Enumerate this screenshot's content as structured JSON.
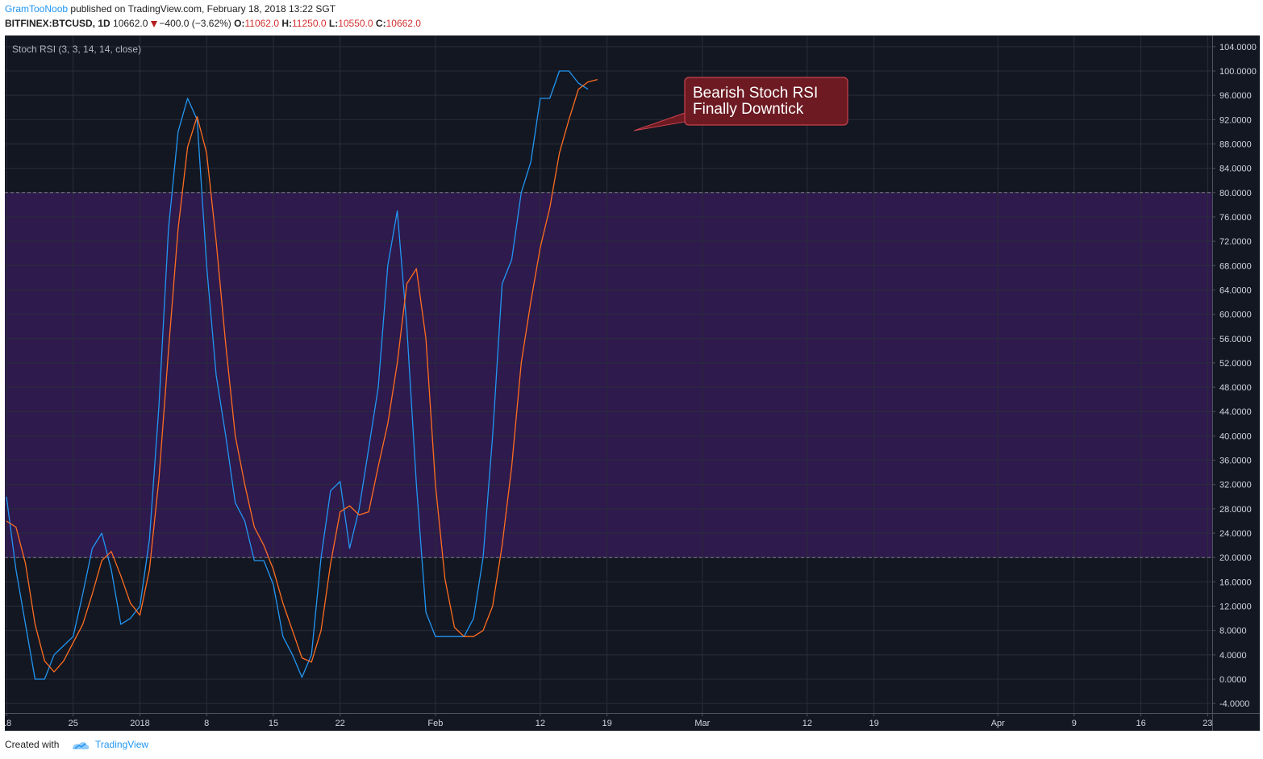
{
  "header": {
    "author": "GramTooNoob",
    "published_text": "published on TradingView.com, February 18, 2018 13:22 SGT",
    "symbol": "BITFINEX:BTCUSD, 1D",
    "price": "10662.0",
    "change": "−400.0 (−3.62%)",
    "o_label": "O:",
    "o_value": "11062.0",
    "h_label": "H:",
    "h_value": "11250.0",
    "l_label": "L:",
    "l_value": "10550.0",
    "c_label": "C:",
    "c_value": "10662.0"
  },
  "footer": {
    "created_with": "Created with",
    "brand": "TradingView"
  },
  "colors": {
    "background": "#131722",
    "band": "#2e1a4d",
    "k_line": "#2196f3",
    "d_line": "#ff6d1f",
    "annotation_bg": "#6d1a22",
    "annotation_border": "#c9434d"
  },
  "chart_data": {
    "type": "line",
    "title": "Stoch RSI (3, 3, 14, 14, close)",
    "annotation": [
      "Bearish Stoch RSI",
      "Finally Downtick"
    ],
    "ylim": [
      -5.5,
      105.5
    ],
    "y_ticks": [
      "104.0000",
      "100.0000",
      "96.0000",
      "92.0000",
      "88.0000",
      "84.0000",
      "80.0000",
      "76.0000",
      "72.0000",
      "68.0000",
      "64.0000",
      "60.0000",
      "56.0000",
      "52.0000",
      "48.0000",
      "44.0000",
      "40.0000",
      "36.0000",
      "32.0000",
      "28.0000",
      "24.0000",
      "20.0000",
      "16.0000",
      "12.0000",
      "8.0000",
      "4.0000",
      "0.0000",
      "-4.0000"
    ],
    "band": [
      20,
      80
    ],
    "x_ticks": [
      {
        "label": "18",
        "day": 0
      },
      {
        "label": "25",
        "day": 7
      },
      {
        "label": "2018",
        "day": 14
      },
      {
        "label": "8",
        "day": 21
      },
      {
        "label": "15",
        "day": 28
      },
      {
        "label": "22",
        "day": 35
      },
      {
        "label": "Feb",
        "day": 45
      },
      {
        "label": "12",
        "day": 56
      },
      {
        "label": "19",
        "day": 63
      },
      {
        "label": "Mar",
        "day": 73
      },
      {
        "label": "12",
        "day": 84
      },
      {
        "label": "19",
        "day": 91
      },
      {
        "label": "Apr",
        "day": 104
      },
      {
        "label": "9",
        "day": 112
      },
      {
        "label": "16",
        "day": 119
      },
      {
        "label": "23",
        "day": 126
      }
    ],
    "series": [
      {
        "values": [
          30,
          18,
          9,
          0,
          0,
          4,
          5.5,
          7,
          14,
          21.5,
          24,
          18,
          9,
          10,
          12,
          23,
          45,
          74,
          90,
          95.5,
          92,
          68,
          50,
          40,
          29,
          26,
          19.5,
          19.5,
          15.5,
          7,
          4,
          0.3,
          4,
          20,
          31,
          32.5,
          21.5,
          28,
          38,
          48,
          68,
          77,
          58,
          32,
          11,
          7,
          7,
          7,
          7,
          10,
          20,
          40,
          65,
          69,
          80,
          85,
          95.5,
          95.5,
          100,
          100,
          98,
          97
        ]
      },
      {
        "values": [
          26,
          25,
          19,
          9,
          3,
          1.2,
          3,
          6,
          9,
          14,
          19.5,
          21,
          17,
          12.5,
          10.5,
          18,
          33,
          54,
          74,
          87.5,
          92.5,
          86.5,
          72,
          55,
          40,
          32,
          25,
          22,
          18,
          12.5,
          8,
          3.5,
          2.8,
          8,
          19,
          27.5,
          28.5,
          27,
          27.5,
          35,
          42,
          52,
          65,
          67.5,
          56,
          32,
          16.5,
          8.5,
          7,
          7,
          8,
          12,
          22,
          35,
          52,
          62,
          71,
          77.5,
          86.5,
          92,
          97,
          98.2,
          98.6
        ]
      }
    ]
  }
}
